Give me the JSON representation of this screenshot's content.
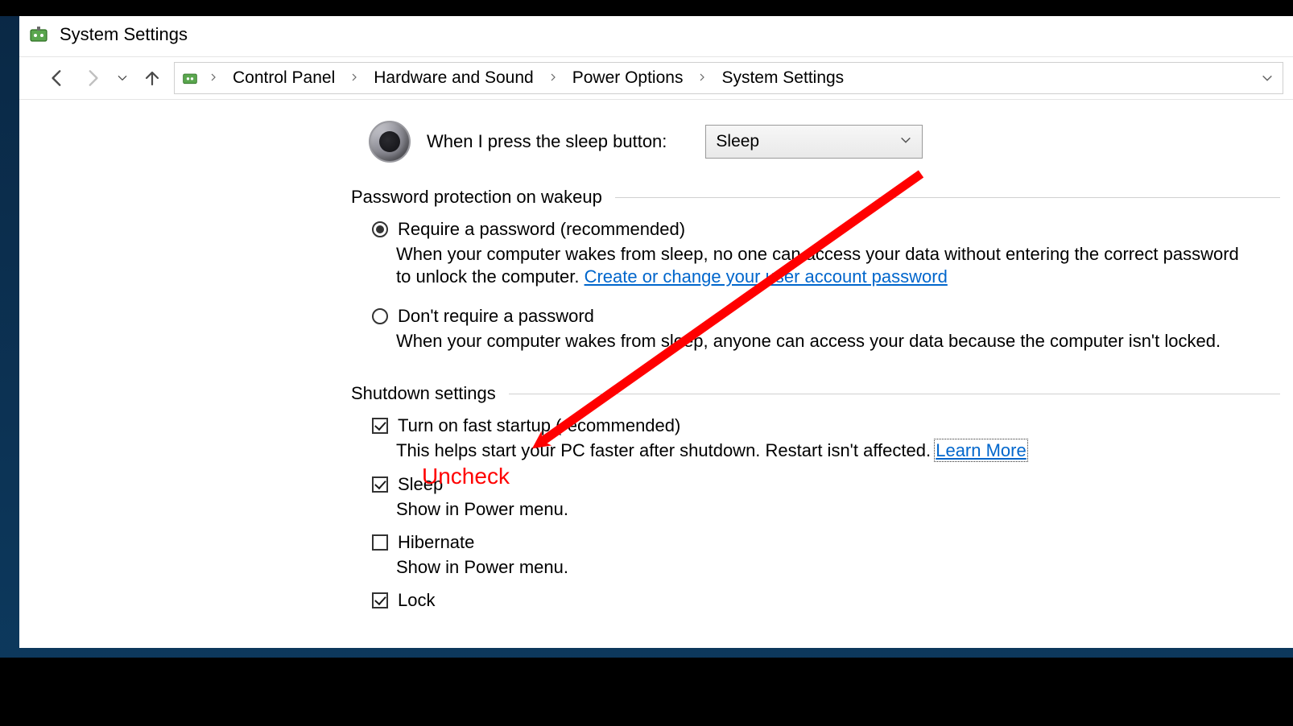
{
  "window": {
    "title": "System Settings"
  },
  "breadcrumb": {
    "items": [
      "Control Panel",
      "Hardware and Sound",
      "Power Options",
      "System Settings"
    ]
  },
  "sleep_button": {
    "label": "When I press the sleep button:",
    "value": "Sleep"
  },
  "sections": {
    "password": {
      "title": "Password protection on wakeup",
      "opt_require": {
        "label": "Require a password (recommended)",
        "desc_prefix": "When your computer wakes from sleep, no one can access your data without entering the correct password to unlock the computer. ",
        "link": "Create or change your user account password",
        "checked": true
      },
      "opt_norequire": {
        "label": "Don't require a password",
        "desc": "When your computer wakes from sleep, anyone can access your data because the computer isn't locked.",
        "checked": false
      }
    },
    "shutdown": {
      "title": "Shutdown settings",
      "faststartup": {
        "label": "Turn on fast startup (recommended)",
        "desc_prefix": "This helps start your PC faster after shutdown. Restart isn't affected. ",
        "link": "Learn More",
        "checked": true
      },
      "sleep": {
        "label": "Sleep",
        "desc": "Show in Power menu.",
        "checked": true
      },
      "hibernate": {
        "label": "Hibernate",
        "desc": "Show in Power menu.",
        "checked": false
      },
      "lock": {
        "label": "Lock",
        "checked": true
      }
    }
  },
  "annotation": {
    "label": "Uncheck"
  }
}
